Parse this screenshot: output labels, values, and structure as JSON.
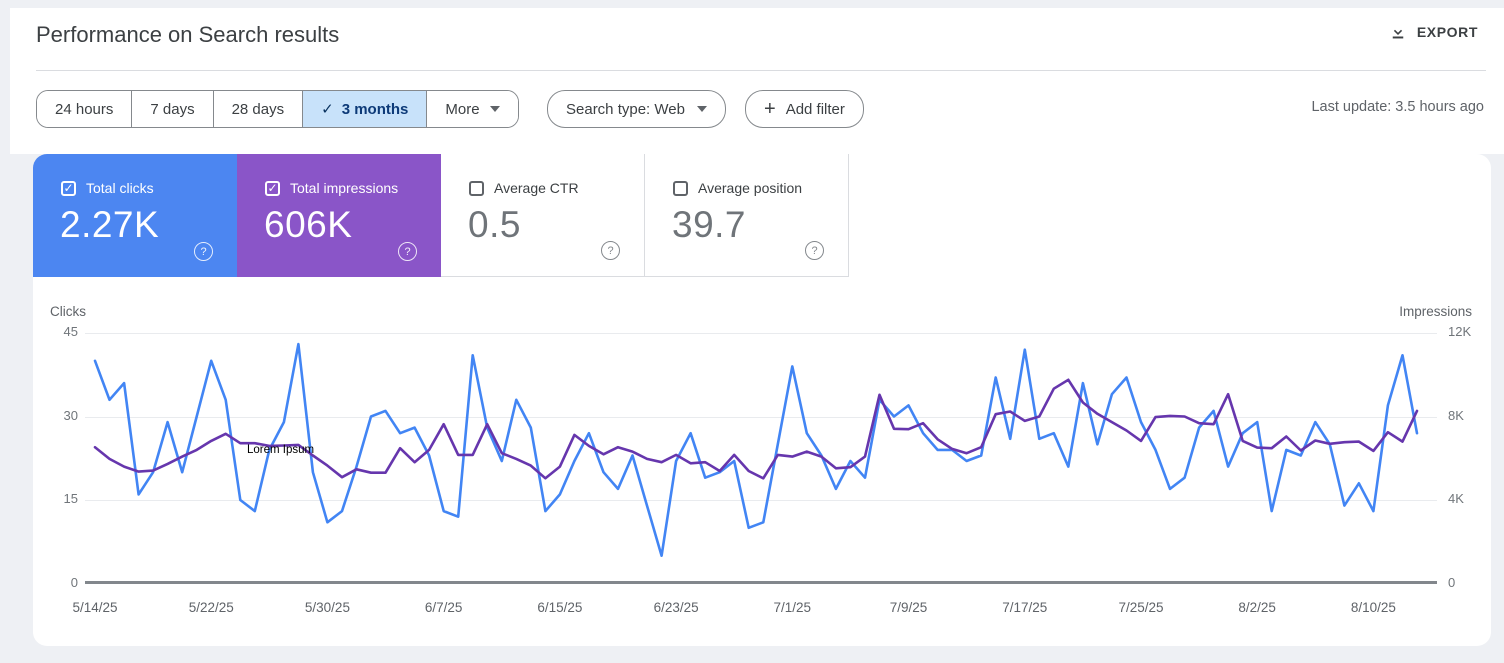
{
  "header": {
    "title": "Performance on Search results",
    "export_label": "EXPORT"
  },
  "filters": {
    "date_ranges": [
      {
        "label": "24 hours",
        "selected": false
      },
      {
        "label": "7 days",
        "selected": false
      },
      {
        "label": "28 days",
        "selected": false
      },
      {
        "label": "3 months",
        "selected": true
      },
      {
        "label": "More",
        "selected": false
      }
    ],
    "search_type_label": "Search type: Web",
    "add_filter_label": "Add filter",
    "last_update": "Last update: 3.5 hours ago"
  },
  "metrics": [
    {
      "label": "Total clicks",
      "value": "2.27K",
      "checked": true,
      "color": "#4c86f1"
    },
    {
      "label": "Total impressions",
      "value": "606K",
      "checked": true,
      "color": "#8a55c8"
    },
    {
      "label": "Average CTR",
      "value": "0.5",
      "checked": false,
      "color": "#ffffff"
    },
    {
      "label": "Average position",
      "value": "39.7",
      "checked": false,
      "color": "#ffffff"
    }
  ],
  "chart_data": {
    "type": "line",
    "title": "Performance on Search results",
    "grid": true,
    "annotation": "Lorem Ipsum",
    "left_axis": {
      "label": "Clicks",
      "ticks": [
        "45",
        "30",
        "15",
        "0"
      ],
      "range": [
        0,
        45
      ]
    },
    "right_axis": {
      "label": "Impressions",
      "ticks": [
        "12K",
        "8K",
        "4K",
        "0"
      ],
      "range": [
        0,
        12000
      ]
    },
    "x_tick_labels": [
      "5/14/25",
      "5/22/25",
      "5/30/25",
      "6/7/25",
      "6/15/25",
      "6/23/25",
      "7/1/25",
      "7/9/25",
      "7/17/25",
      "7/25/25",
      "8/2/25",
      "8/10/25"
    ],
    "x_tick_day_step": 8,
    "series": [
      {
        "name": "Total clicks",
        "axis": "left",
        "color": "#4285f4",
        "values": [
          40,
          33,
          36,
          16,
          20,
          29,
          20,
          30,
          40,
          33,
          15,
          13,
          24,
          29,
          43,
          20,
          11,
          13,
          21,
          30,
          31,
          27,
          28,
          23,
          13,
          12,
          41,
          28,
          22,
          33,
          28,
          13,
          16,
          22,
          27,
          20,
          17,
          23,
          14,
          5,
          22,
          27,
          19,
          20,
          22,
          10,
          11,
          25,
          39,
          27,
          23,
          17,
          22,
          19,
          33,
          30,
          32,
          27,
          24,
          24,
          22,
          23,
          37,
          26,
          42,
          26,
          27,
          21,
          36,
          25,
          34,
          37,
          29,
          24,
          17,
          19,
          28,
          31,
          21,
          27,
          29,
          13,
          24,
          23,
          29,
          25,
          14,
          18,
          13,
          32,
          41,
          27
        ]
      },
      {
        "name": "Total impressions",
        "axis": "right",
        "color": "#6636ad",
        "values": [
          6530,
          5970,
          5600,
          5360,
          5410,
          5730,
          6080,
          6400,
          6830,
          7170,
          6720,
          6720,
          6590,
          6610,
          6640,
          6130,
          5650,
          5090,
          5470,
          5310,
          5310,
          6480,
          5810,
          6400,
          7630,
          6160,
          6160,
          7630,
          6240,
          5970,
          5650,
          5040,
          5600,
          7120,
          6590,
          6190,
          6530,
          6320,
          5970,
          5810,
          6160,
          5760,
          5810,
          5390,
          6160,
          5390,
          5040,
          6160,
          6080,
          6320,
          6080,
          5520,
          5570,
          6080,
          9040,
          7410,
          7390,
          7680,
          6910,
          6450,
          6240,
          6530,
          8110,
          8240,
          7790,
          8000,
          9330,
          9760,
          8670,
          8130,
          7730,
          7330,
          6830,
          7970,
          8030,
          8000,
          7680,
          7630,
          9070,
          6830,
          6510,
          6480,
          7040,
          6370,
          6850,
          6690,
          6770,
          6800,
          6350,
          7250,
          6800,
          8270
        ]
      }
    ]
  }
}
